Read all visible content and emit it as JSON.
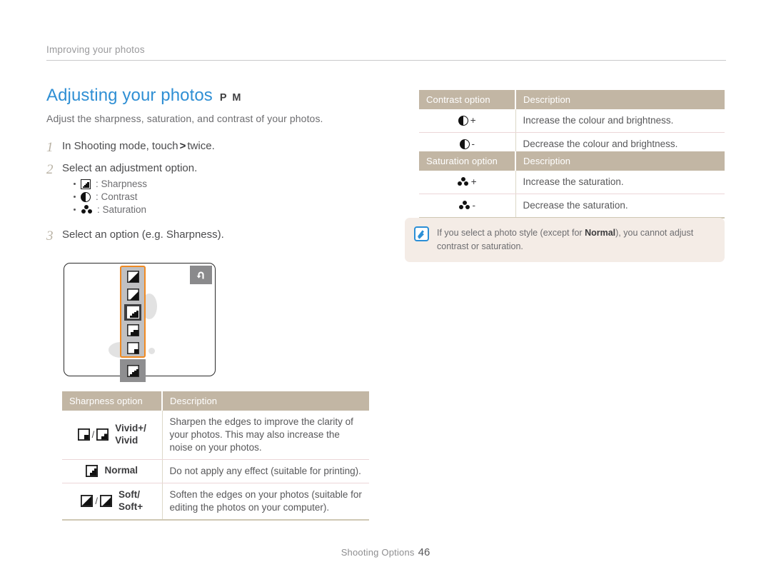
{
  "runhead": {
    "text": "Improving your photos"
  },
  "heading": {
    "title": "Adjusting your photos",
    "modes": "P M",
    "subtitle": "Adjust the sharpness, saturation, and contrast of your photos."
  },
  "steps": [
    {
      "num": "1",
      "text_before": "In Shooting mode, touch",
      "glyph": ">",
      "text_after": "twice."
    },
    {
      "num": "2",
      "text_before": "Select an adjustment option.",
      "glyph": "",
      "text_after": ""
    },
    {
      "num": "3",
      "text_before": "Select an option (e.g. Sharpness).",
      "glyph": "",
      "text_after": ""
    }
  ],
  "bullets": [
    {
      "icon": "sharpness-icon",
      "label": ": Sharpness"
    },
    {
      "icon": "contrast-icon",
      "label": ": Contrast"
    },
    {
      "icon": "saturation-icon",
      "label": ": Saturation"
    }
  ],
  "camera_screen": {
    "back_button_glyph": "↩",
    "selected_index": 2,
    "items": [
      {
        "name": "sharpness-vivid-plus-icon"
      },
      {
        "name": "sharpness-vivid-icon"
      },
      {
        "name": "sharpness-normal-icon"
      },
      {
        "name": "sharpness-soft-icon"
      },
      {
        "name": "sharpness-soft-plus-icon"
      }
    ],
    "extra_item": {
      "name": "sharpness-extra-icon"
    }
  },
  "sharpness_table": {
    "headers": [
      "Sharpness option",
      "Description"
    ],
    "rows": [
      {
        "glyphs": 2,
        "label": "Vivid+/\nVivid",
        "label_lines": [
          "Vivid+/",
          "Vivid"
        ],
        "description": "Sharpen the edges to improve the clarity of your photos. This may also increase the noise on your photos."
      },
      {
        "glyphs": 1,
        "label_lines": [
          "Normal"
        ],
        "description": "Do not apply any effect (suitable for printing)."
      },
      {
        "glyphs": 2,
        "label_lines": [
          "Soft/",
          "Soft+"
        ],
        "description": "Soften the edges on your photos (suitable for editing the photos on your computer)."
      }
    ]
  },
  "contrast_table": {
    "headers": [
      "Contrast option",
      "Description"
    ],
    "rows": [
      {
        "sign": "+",
        "description": "Increase the colour and brightness."
      },
      {
        "sign": "-",
        "description": "Decrease the colour and brightness."
      }
    ]
  },
  "saturation_table": {
    "headers": [
      "Saturation option",
      "Description"
    ],
    "rows": [
      {
        "sign": "+",
        "description": "Increase the saturation."
      },
      {
        "sign": "-",
        "description": "Decrease the saturation."
      }
    ]
  },
  "note": {
    "text_before": "If you select a photo style (except for ",
    "bold": "Normal",
    "text_after": "), you cannot adjust contrast or saturation."
  },
  "footer": {
    "label": "Shooting Options",
    "page": "46"
  },
  "colors": {
    "title": "#2f8fd4",
    "table_header_bg": "#c2b6a4",
    "note_bg": "#f4ece6",
    "highlight_orange": "#f08a22",
    "note_icon": "#2b8fd6"
  }
}
